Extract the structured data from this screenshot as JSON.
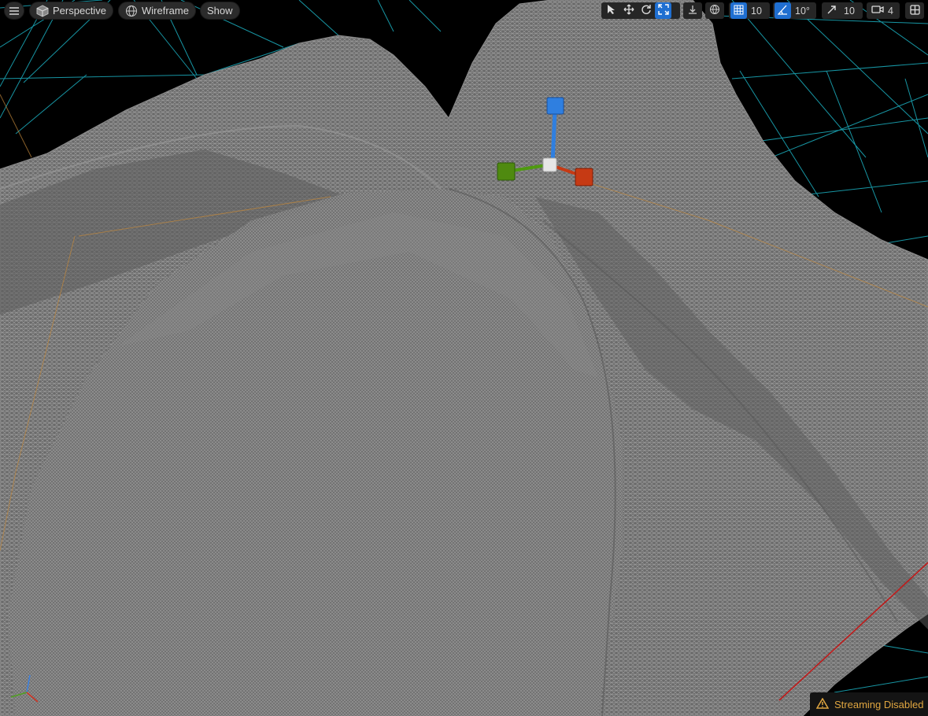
{
  "toolbar_left": {
    "menu_icon": "hamburger-icon",
    "view_mode_label": "Perspective",
    "view_mode_icon": "cube-icon",
    "render_mode_label": "Wireframe",
    "render_mode_icon": "sphere-wireframe-icon",
    "show_label": "Show"
  },
  "toolbar_right": {
    "tools": [
      {
        "name": "select",
        "icon": "cursor-icon",
        "active": false
      },
      {
        "name": "translate",
        "icon": "move-arrows-icon",
        "active": false
      },
      {
        "name": "rotate",
        "icon": "rotate-icon",
        "active": false
      },
      {
        "name": "scale",
        "icon": "scale-icon",
        "active": true
      }
    ],
    "surface_snap_icon": "surface-snap-icon",
    "world_local_icon": "globe-icon",
    "grid_snap_value": "10",
    "rotation_snap_value": "10°",
    "scale_snap_value": "10",
    "camera_speed_value": "4",
    "layout_icon": "viewport-layout-icon",
    "accent_color": "#1f6fd1"
  },
  "status": {
    "text": "Streaming Disabled",
    "icon": "warning-icon",
    "color": "#e0a640"
  },
  "gizmo": {
    "x_axis_color": "#c63a14",
    "y_axis_color": "#4f9a10",
    "z_axis_color": "#2f7fe0"
  }
}
